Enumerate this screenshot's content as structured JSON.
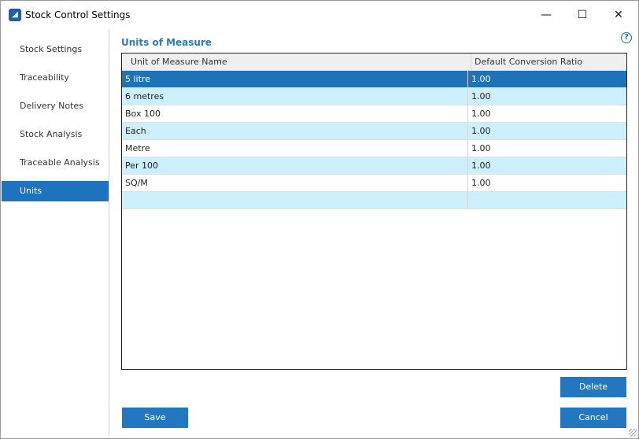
{
  "window": {
    "title": "Stock Control Settings",
    "minimize": "—",
    "maximize": "☐",
    "close": "✕"
  },
  "sidebar": {
    "items": [
      {
        "label": "Stock Settings"
      },
      {
        "label": "Traceability"
      },
      {
        "label": "Delivery Notes"
      },
      {
        "label": "Stock Analysis"
      },
      {
        "label": "Traceable Analysis"
      },
      {
        "label": "Units"
      }
    ]
  },
  "main": {
    "heading": "Units of Measure",
    "help": "?",
    "table": {
      "columns": [
        "Unit of Measure Name",
        "Default Conversion Ratio"
      ],
      "rows": [
        [
          "5 litre",
          "1.00"
        ],
        [
          "6 metres",
          "1.00"
        ],
        [
          "Box 100",
          "1.00"
        ],
        [
          "Each",
          "1.00"
        ],
        [
          "Metre",
          "1.00"
        ],
        [
          "Per 100",
          "1.00"
        ],
        [
          "SQ/M",
          "1.00"
        ]
      ]
    }
  },
  "buttons": {
    "delete": "Delete",
    "save": "Save",
    "cancel": "Cancel"
  }
}
